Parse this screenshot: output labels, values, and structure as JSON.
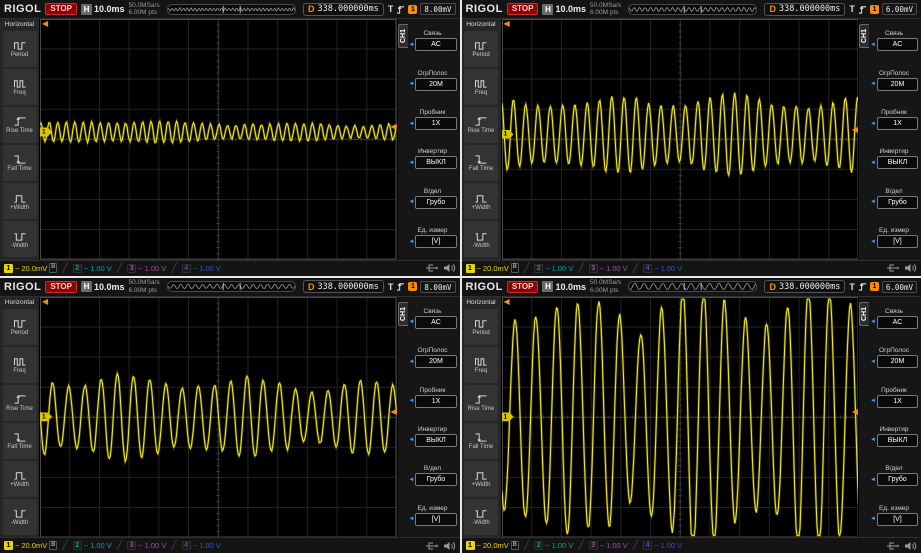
{
  "panel_common": {
    "brand": "RIGOL",
    "run_status": "STOP",
    "horizontal": {
      "label": "H",
      "scale": "10.0ms"
    },
    "acquisition": {
      "sample_rate": "50.0MSa/s",
      "memory_depth": "6.00M pts"
    },
    "delay": {
      "label": "D",
      "value": "338.000000ms"
    },
    "trigger": {
      "label": "T",
      "source": "1"
    },
    "left_menu": {
      "title": "Horizontal",
      "items": [
        {
          "label": "Period"
        },
        {
          "label": "Freq"
        },
        {
          "label": "Rise Time"
        },
        {
          "label": "Fall Time"
        },
        {
          "label": "+Width"
        },
        {
          "label": "-Width"
        }
      ]
    },
    "right_menu": {
      "tab": "CH1",
      "items": [
        {
          "label": "Связь",
          "value": "AC"
        },
        {
          "label": "ОгрПолос",
          "value": "20M"
        },
        {
          "label": "Пробник",
          "value": "1X"
        },
        {
          "label": "Инвертир",
          "value": "ВЫКЛ"
        },
        {
          "label": "В/дел",
          "value": "Грубо"
        },
        {
          "label": "Ед. измер",
          "value": "[V]"
        }
      ]
    },
    "bottom_bar": {
      "channels": [
        {
          "num": "1",
          "coupling": "~",
          "scale": "20.0mV",
          "badge": "B",
          "color": "#e6d700"
        },
        {
          "num": "2",
          "coupling": "~",
          "scale": "1.00 V",
          "color": "#00d8d8"
        },
        {
          "num": "3",
          "coupling": "~",
          "scale": "1.00 V",
          "color": "#d860d8"
        },
        {
          "num": "4",
          "coupling": "~",
          "scale": "1.00 V",
          "color": "#4a6aff"
        }
      ]
    },
    "markers": {
      "channel_marker": "1"
    },
    "accent_colors": {
      "trace": "#f0e71f",
      "trigger_orange": "#ff8c00"
    }
  },
  "panels": [
    {
      "trigger_level": "8.00mV",
      "wave": {
        "cycles": 42,
        "amplitude_frac": 0.07,
        "center_frac": 0.47
      }
    },
    {
      "trigger_level": "6.00mV",
      "wave": {
        "cycles": 29,
        "amplitude_frac": 0.26,
        "center_frac": 0.48
      }
    },
    {
      "trigger_level": "8.00mV",
      "wave": {
        "cycles": 22,
        "amplitude_frac": 0.3,
        "center_frac": 0.5
      }
    },
    {
      "trigger_level": "6.00mV",
      "wave": {
        "cycles": 17,
        "amplitude_frac": 0.93,
        "center_frac": 0.5
      }
    }
  ],
  "chart_data": [
    {
      "type": "line",
      "panel": "top-left",
      "signal": "sine",
      "time_per_div": "10.0ms",
      "volts_per_div": "20.0mV",
      "cycles_visible": 42,
      "peak_amplitude_divisions": 0.3
    },
    {
      "type": "line",
      "panel": "top-right",
      "signal": "sine",
      "time_per_div": "10.0ms",
      "volts_per_div": "20.0mV",
      "cycles_visible": 29,
      "peak_amplitude_divisions": 1.0
    },
    {
      "type": "line",
      "panel": "bottom-left",
      "signal": "sine",
      "time_per_div": "10.0ms",
      "volts_per_div": "20.0mV",
      "cycles_visible": 22,
      "peak_amplitude_divisions": 1.2
    },
    {
      "type": "line",
      "panel": "bottom-right",
      "signal": "sine",
      "time_per_div": "10.0ms",
      "volts_per_div": "20.0mV",
      "cycles_visible": 17,
      "peak_amplitude_divisions": 3.7
    }
  ]
}
